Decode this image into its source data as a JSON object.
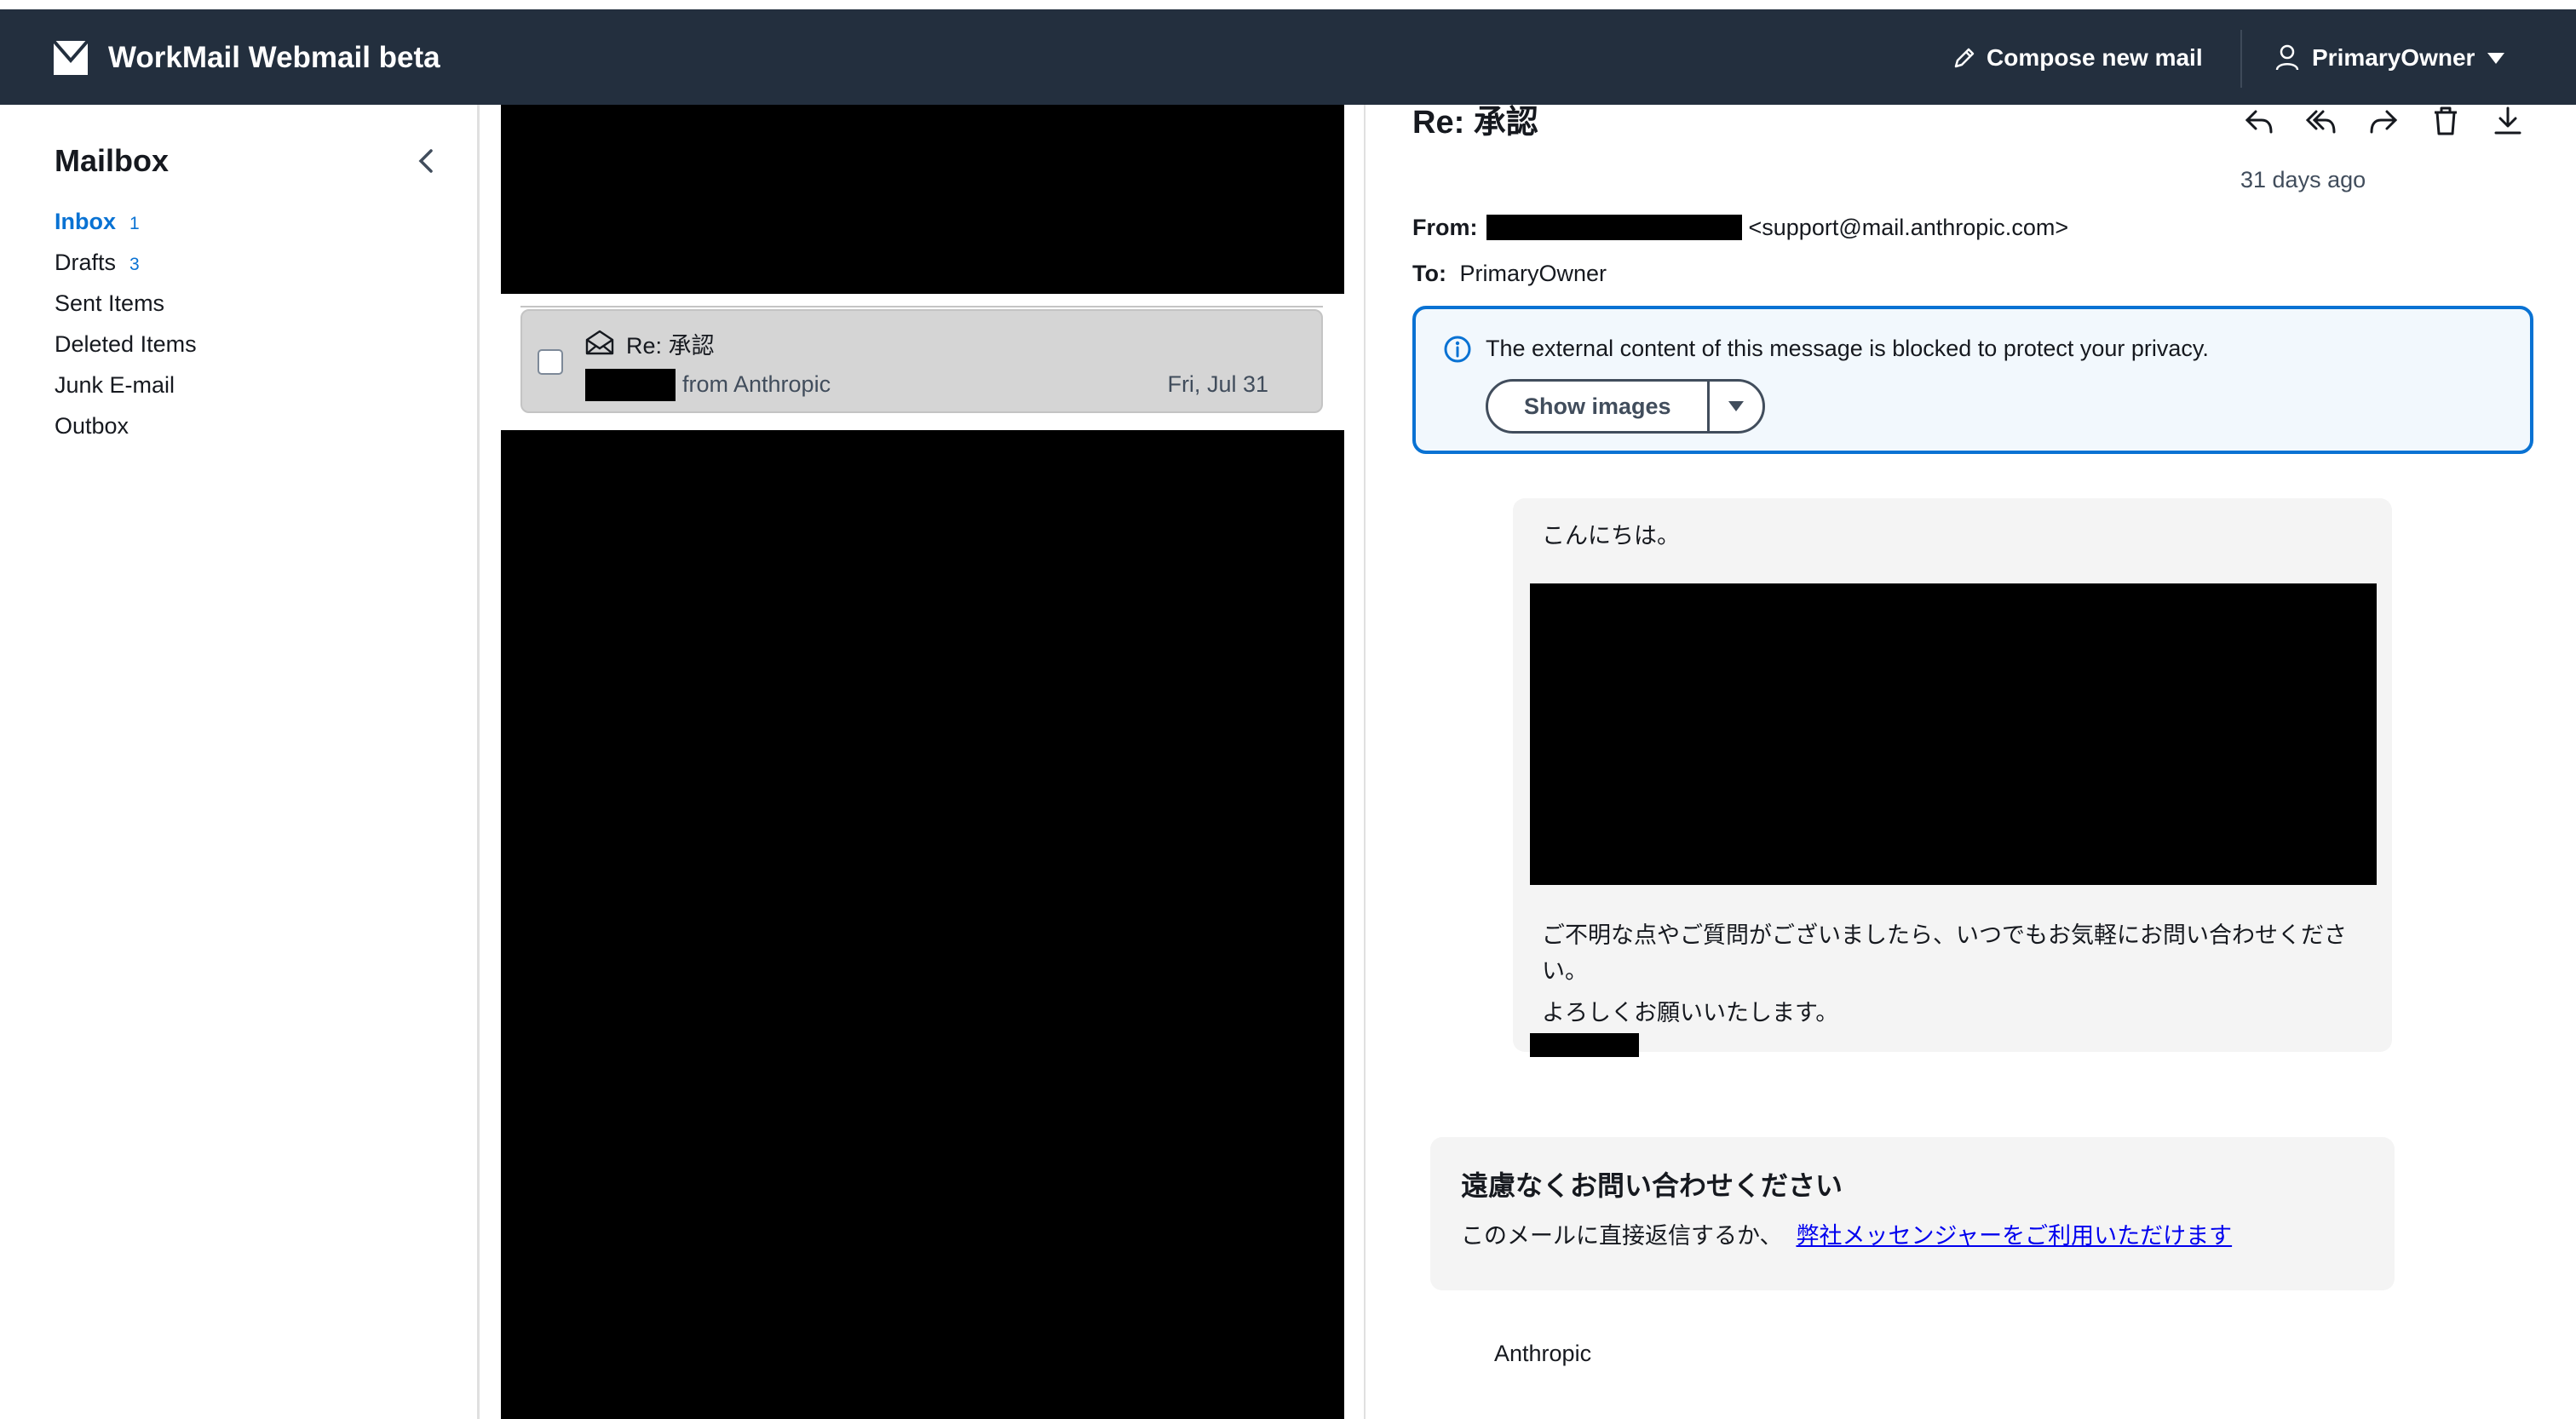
{
  "header": {
    "app_title": "WorkMail Webmail beta",
    "compose_label": "Compose new mail",
    "user_name": "PrimaryOwner",
    "colors": {
      "bar": "#232f3e",
      "text": "#ffffff"
    }
  },
  "sidebar": {
    "title": "Mailbox",
    "folders": [
      {
        "name": "Inbox",
        "count": "1",
        "active": true
      },
      {
        "name": "Drafts",
        "count": "3",
        "active": false
      },
      {
        "name": "Sent Items",
        "count": "",
        "active": false
      },
      {
        "name": "Deleted Items",
        "count": "",
        "active": false
      },
      {
        "name": "Junk E-mail",
        "count": "",
        "active": false
      },
      {
        "name": "Outbox",
        "count": "",
        "active": false
      }
    ]
  },
  "message_list": {
    "selected_item": {
      "subject": "Re: 承認",
      "from": "from Anthropic",
      "date": "Fri, Jul 31",
      "icon": "envelope-open-icon"
    }
  },
  "reader": {
    "subject": "Re: 承認",
    "received": "31 days ago",
    "from_label": "From:",
    "from_email": "<support@mail.anthropic.com>",
    "to_label": "To:",
    "to_value": "PrimaryOwner",
    "notice_text": "The external content of this message is blocked to protect your privacy.",
    "show_images_label": "Show images",
    "body": {
      "greeting": "こんにちは。",
      "paragraph": "ご不明な点やご質問がございましたら、いつでもお気軽にお問い合わせください。",
      "closing": "よろしくお願いいたします。"
    },
    "contact": {
      "title": "遠慮なくお問い合わせください",
      "text": "このメールに直接返信するか、",
      "link": "弊社メッセンジャーをご利用いただけます"
    },
    "footer": "Anthropic",
    "accent": "#0972d3"
  }
}
